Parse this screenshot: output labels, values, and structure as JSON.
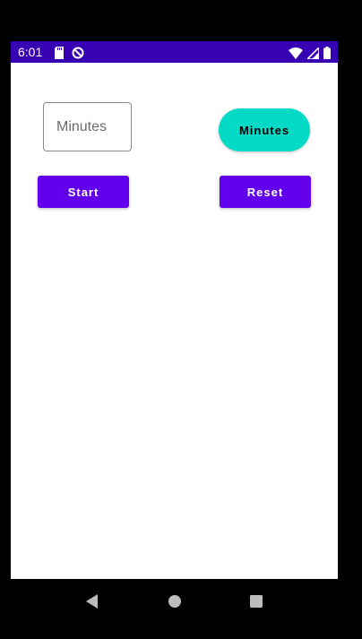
{
  "status_bar": {
    "time": "6:01",
    "left_icons": [
      "sd-card-icon",
      "dnd-icon"
    ],
    "right_icons": [
      "wifi-icon",
      "signal-icon",
      "battery-icon"
    ],
    "background": "#3700b3"
  },
  "form": {
    "minutes_input": {
      "placeholder": "Minutes",
      "value": ""
    },
    "minutes_button_label": "Minutes",
    "start_button_label": "Start",
    "reset_button_label": "Reset"
  },
  "colors": {
    "primary": "#6200ee",
    "secondary": "#03dac5",
    "primary_dark": "#3700b3"
  },
  "navigation": {
    "icons": [
      "back-icon",
      "home-icon",
      "recents-icon"
    ]
  }
}
